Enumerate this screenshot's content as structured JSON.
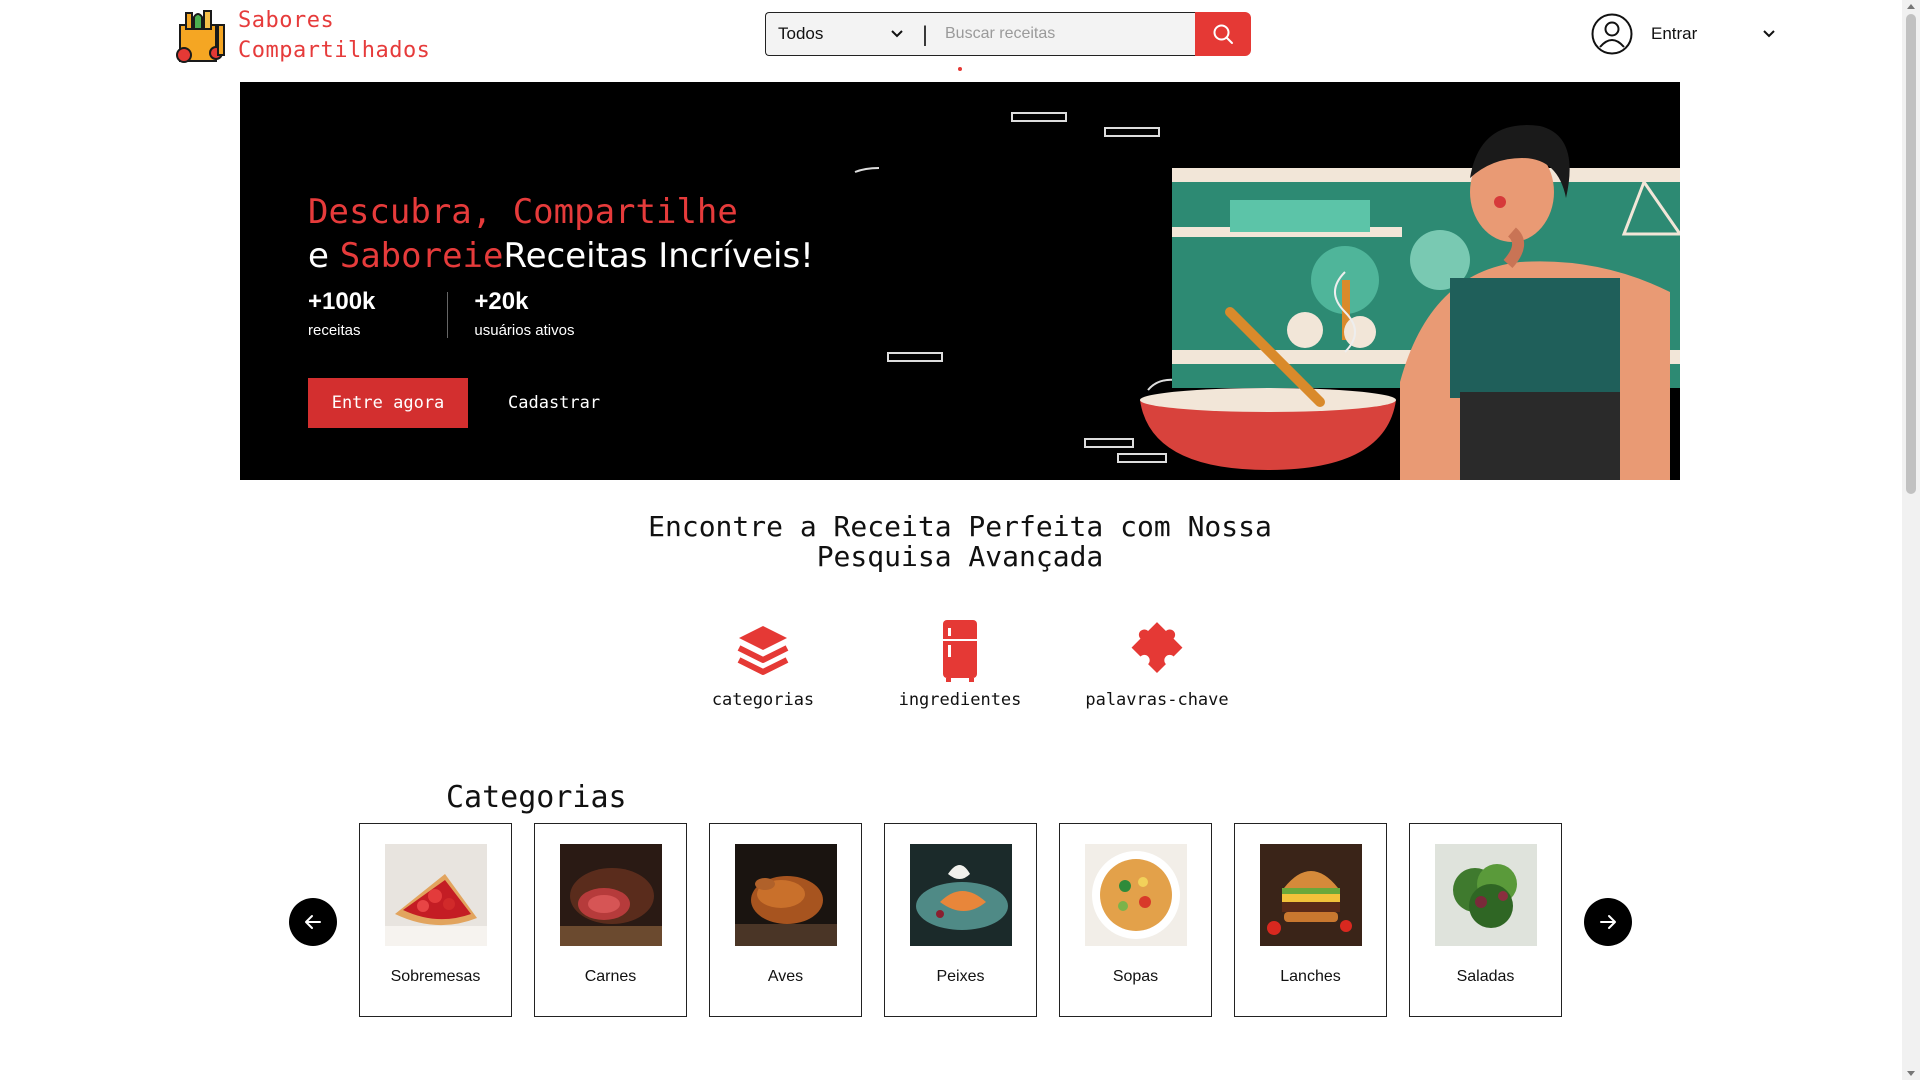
{
  "header": {
    "brand_line1": "Sabores",
    "brand_line2": "Compartilhados",
    "search": {
      "select_value": "Todos",
      "divider": "|",
      "placeholder": "Buscar receitas"
    },
    "account_label": "Entrar"
  },
  "hero": {
    "title_part1": "Descubra, Compartilhe",
    "title_e": "e",
    "title_highlight": "Saboreie",
    "title_part2": "Receitas Incríveis!",
    "stats": [
      {
        "value": "+100k",
        "label": "receitas"
      },
      {
        "value": "+20k",
        "label": "usuários ativos"
      }
    ],
    "primary_button": "Entre agora",
    "secondary_button": "Cadastrar"
  },
  "advanced_search": {
    "title_line1": "Encontre a Receita Perfeita com Nossa",
    "title_line2": "Pesquisa Avançada",
    "items": [
      {
        "label": "categorias",
        "icon": "layers-icon"
      },
      {
        "label": "ingredientes",
        "icon": "fridge-icon"
      },
      {
        "label": "palavras-chave",
        "icon": "puzzle-icon"
      }
    ]
  },
  "categories": {
    "title": "Categorias",
    "items": [
      {
        "name": "Sobremesas"
      },
      {
        "name": "Carnes"
      },
      {
        "name": "Aves"
      },
      {
        "name": "Peixes"
      },
      {
        "name": "Sopas"
      },
      {
        "name": "Lanches"
      },
      {
        "name": "Saladas"
      }
    ]
  },
  "colors": {
    "accent": "#e53935",
    "hero_bg": "#000000",
    "text": "#111111"
  }
}
